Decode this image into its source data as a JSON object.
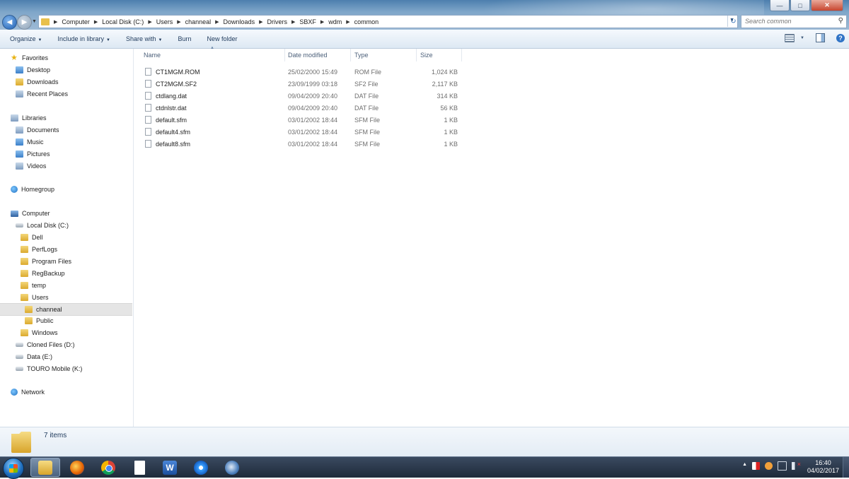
{
  "window": {
    "controls": [
      "minimize",
      "maximize",
      "close"
    ]
  },
  "address": {
    "crumbs": [
      "Computer",
      "Local Disk (C:)",
      "Users",
      "channeal",
      "Downloads",
      "Drivers",
      "SBXF",
      "wdm",
      "common"
    ],
    "search_placeholder": "Search common"
  },
  "toolbar": {
    "organize": "Organize",
    "include_in_library": "Include in library",
    "share_with": "Share with",
    "burn": "Burn",
    "new_folder": "New folder"
  },
  "nav": {
    "favorites": "Favorites",
    "desktop": "Desktop",
    "downloads": "Downloads",
    "recent_places": "Recent Places",
    "libraries": "Libraries",
    "documents": "Documents",
    "music": "Music",
    "pictures": "Pictures",
    "videos": "Videos",
    "homegroup": "Homegroup",
    "computer": "Computer",
    "local_disk": "Local Disk (C:)",
    "dell": "Dell",
    "perflogs": "PerfLogs",
    "program_files": "Program Files",
    "regbackup": "RegBackup",
    "temp": "temp",
    "users": "Users",
    "channeal": "channeal",
    "public": "Public",
    "windows": "Windows",
    "cloned_files": "Cloned Files (D:)",
    "data": "Data (E:)",
    "touro": "TOURO Mobile (K:)",
    "network": "Network"
  },
  "columns": {
    "name": "Name",
    "date_modified": "Date modified",
    "type": "Type",
    "size": "Size"
  },
  "files": [
    {
      "name": "CT1MGM.ROM",
      "date": "25/02/2000 15:49",
      "type": "ROM File",
      "size": "1,024 KB"
    },
    {
      "name": "CT2MGM.SF2",
      "date": "23/09/1999 03:18",
      "type": "SF2 File",
      "size": "2,117 KB"
    },
    {
      "name": "ctdlang.dat",
      "date": "09/04/2009 20:40",
      "type": "DAT File",
      "size": "314 KB"
    },
    {
      "name": "ctdnlstr.dat",
      "date": "09/04/2009 20:40",
      "type": "DAT File",
      "size": "56 KB"
    },
    {
      "name": "default.sfm",
      "date": "03/01/2002 18:44",
      "type": "SFM File",
      "size": "1 KB"
    },
    {
      "name": "default4.sfm",
      "date": "03/01/2002 18:44",
      "type": "SFM File",
      "size": "1 KB"
    },
    {
      "name": "default8.sfm",
      "date": "03/01/2002 18:44",
      "type": "SFM File",
      "size": "1 KB"
    }
  ],
  "details": {
    "item_count": "7 items"
  },
  "taskbar": {
    "apps": [
      "windows-explorer",
      "firefox",
      "chrome",
      "notepad-document",
      "word",
      "internet-explorer",
      "thunderbird"
    ],
    "time": "16:40",
    "date": "04/02/2017"
  }
}
